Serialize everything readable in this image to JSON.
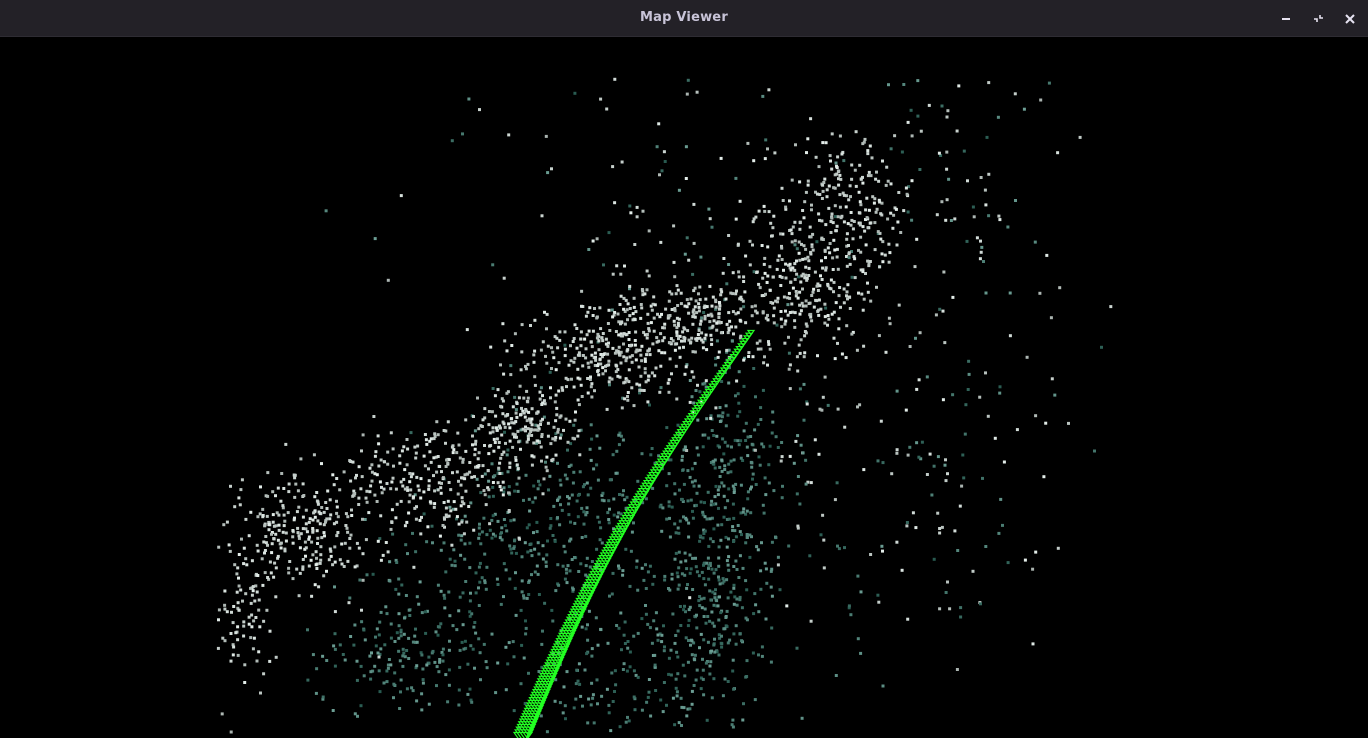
{
  "window": {
    "title": "Map Viewer",
    "buttons": {
      "minimize_icon": "minimize-icon",
      "restore_icon": "restore-icon",
      "close_icon": "close-icon"
    }
  },
  "colors": {
    "titlebar_bg": "#232127",
    "title_text": "#c8c4d8",
    "viewport_bg": "#000000",
    "trajectory": "#22ff22",
    "points_bright": "#d8dedc",
    "points_dim": "#4f7470"
  }
}
